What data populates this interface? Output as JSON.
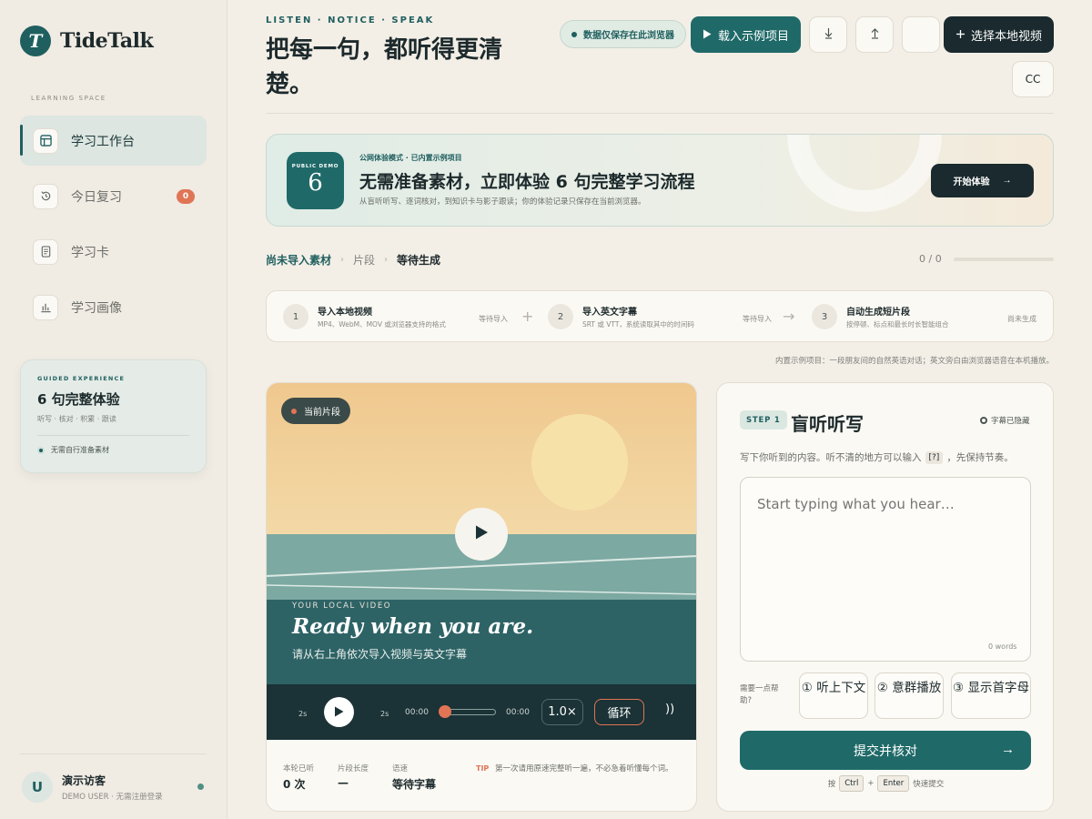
{
  "brand": {
    "initial": "T",
    "name": "TideTalk"
  },
  "sidebar": {
    "caption": "LEARNING SPACE",
    "items": [
      {
        "label": "学习工作台",
        "icon": "layout-icon",
        "active": true
      },
      {
        "label": "今日复习",
        "icon": "history-icon",
        "badge": "0"
      },
      {
        "label": "学习卡",
        "icon": "card-icon"
      },
      {
        "label": "学习画像",
        "icon": "chart-icon"
      }
    ],
    "guided": {
      "caption": "GUIDED EXPERIENCE",
      "title": "6 句完整体验",
      "subtitle": "听写 · 核对 · 积累 · 跟读",
      "note": "无需自行准备素材"
    },
    "user": {
      "initial": "U",
      "name": "演示访客",
      "sub": "DEMO USER · 无需注册登录"
    }
  },
  "header": {
    "eyebrow": "LISTEN · NOTICE · SPEAK",
    "title": "把每一句，都听得更清楚。",
    "save_pill": "数据仅保存在此浏览器",
    "demo_button": "载入示例项目",
    "local_button": "选择本地视频",
    "cc_button": "CC"
  },
  "banner": {
    "tile_caption": "PUBLIC DEMO",
    "tile_number": "6",
    "caption": "公网体验模式 · 已内置示例项目",
    "title": "无需准备素材，立即体验 6 句完整学习流程",
    "subtitle": "从盲听听写、逐词核对，到知识卡与影子跟读；你的体验记录只保存在当前浏览器。",
    "button": "开始体验"
  },
  "crumb": {
    "c1": "尚未导入素材",
    "c2": "片段",
    "c3": "等待生成",
    "progress": "0 / 0"
  },
  "steps": [
    {
      "num": "1",
      "title": "导入本地视频",
      "desc": "MP4、WebM、MOV 或浏览器支持的格式",
      "status": "等待导入"
    },
    {
      "num": "2",
      "title": "导入英文字幕",
      "desc": "SRT 或 VTT，系统读取其中的时间码",
      "status": "等待导入"
    },
    {
      "num": "3",
      "title": "自动生成短片段",
      "desc": "按停顿、标点和最长时长智能组合",
      "status": "尚未生成"
    }
  ],
  "note": "内置示例项目：一段朋友间的自然英语对话；英文旁白由浏览器语音在本机播放。",
  "video": {
    "chip": "当前片段",
    "caption": "YOUR LOCAL VIDEO",
    "title": "Ready when you are.",
    "subtitle": "请从右上角依次导入视频与英文字幕",
    "back": "2s",
    "fwd": "2s",
    "time_start": "00:00",
    "time_end": "00:00",
    "rate": "1.0×",
    "loop": "循环",
    "volume": "))",
    "stats": [
      {
        "label": "本轮已听",
        "value": "0 次"
      },
      {
        "label": "片段长度",
        "value": "—"
      },
      {
        "label": "语速",
        "value": "等待字幕"
      }
    ],
    "tip_tag": "TIP",
    "tip": "第一次请用原速完整听一遍，不必急着听懂每个词。"
  },
  "dictation": {
    "tag": "STEP 1",
    "title": "盲听听写",
    "hidden_sub": "字幕已隐藏",
    "hint_pre": "写下你听到的内容。听不清的地方可以输入",
    "hint_key": "[?]",
    "hint_post": "，先保持节奏。",
    "placeholder": "Start typing what you hear…",
    "word_count": "0 words",
    "help_label": "需要一点帮助?",
    "help_buttons": [
      "① 听上下文",
      "② 意群播放",
      "③ 显示首字母"
    ],
    "submit": "提交并核对",
    "shortcut_pre": "按",
    "key1": "Ctrl",
    "plus": "+",
    "key2": "Enter",
    "shortcut_post": "快速提交"
  },
  "colors": {
    "accent": "#1f6a68",
    "dark": "#1a2a2e",
    "warn": "#e07556",
    "bg": "#f3efe7"
  }
}
